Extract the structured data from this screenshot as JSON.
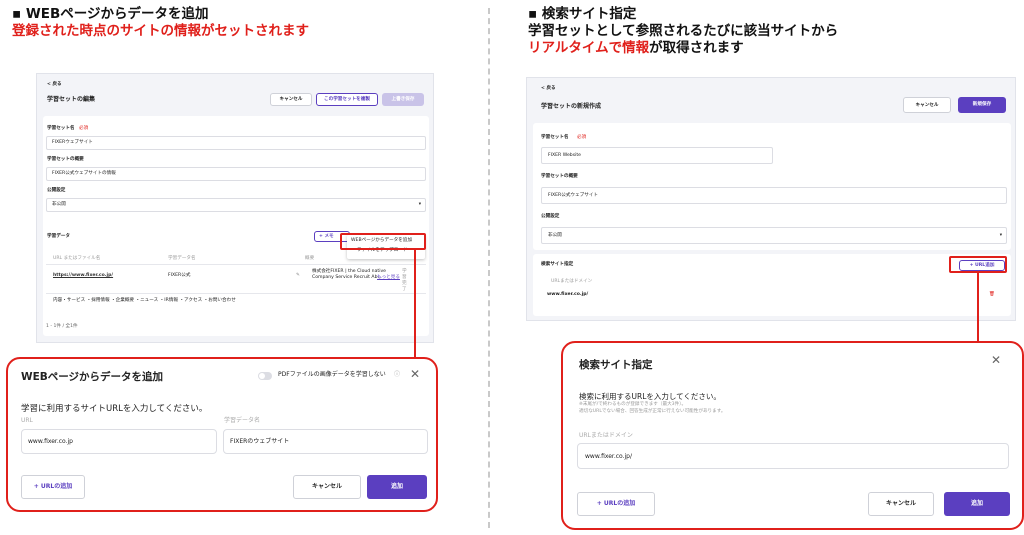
{
  "left": {
    "heading": "▪ WEBページからデータを追加",
    "subheading": "登録された時点のサイトの情報がセットされます",
    "screen": {
      "back": "< 戻る",
      "title": "学習セットの編集",
      "cancel": "キャンセル",
      "copy_button": "この学習セットを複製",
      "save_button": "上書き保存",
      "name_label": "学習セット名",
      "required": "必須",
      "name_value": "FIXERウェブサイト",
      "summary_label": "学習セットの概要",
      "summary_value": "FIXER公式ウェブサイトの情報",
      "public_label": "公開設定",
      "public_value": "非公開",
      "data_label": "学習データ",
      "add_memo": "+ メモ",
      "menu_web": "WEBページからデータを追加",
      "menu_file": "ファイルをアップロード",
      "col_url": "URL またはファイル名",
      "col_name": "学習データ名",
      "col_summary": "概要",
      "row_url": "https://www.fixer.co.jp/",
      "row_name": "FIXER公式",
      "row_summary_1": "株式会社FIXER | the Cloud native",
      "row_summary_2": "Company Service Recruit Ab...",
      "row_more": "もっと見る",
      "row_status": "学習完了",
      "row_tags": "内容・サービス ・採用情報 ・企業概要 ・ニュース ・IR情報 ・アクセス ・お問い合わせ",
      "pagination": "1 - 1件 / 全1件"
    },
    "modal": {
      "title": "WEBページからデータを追加",
      "toggle_label": "PDFファイルの画像データを学習しない",
      "info_icon": "ⓘ",
      "close_icon": "✕",
      "instruction": "学習に利用するサイトURLを入力してください。",
      "url_label": "URL",
      "url_value": "www.fixer.co.jp",
      "name_label": "学習データ名",
      "name_value": "FIXERのウェブサイト",
      "add_url": "+ URLの追加",
      "cancel": "キャンセル",
      "submit": "追加"
    }
  },
  "right": {
    "heading": "▪ 検索サイト指定",
    "subheading_1": "学習セットとして参照されるたびに該当サイトから",
    "subheading_2_red": "リアルタイムで情報",
    "subheading_2_rest": "が取得されます",
    "screen": {
      "back": "< 戻る",
      "title": "学習セットの新規作成",
      "cancel": "キャンセル",
      "save_button": "新規保存",
      "name_label": "学習セット名",
      "required": "必須",
      "name_value": "FIXER Website",
      "summary_label": "学習セットの概要",
      "summary_value": "FIXER公式ウェブサイト",
      "public_label": "公開設定",
      "public_value": "非公開",
      "search_label": "検索サイト指定",
      "url_add": "+ URL追加",
      "url_col": "URLまたはドメイン",
      "url_value": "www.fixer.co.jp/"
    },
    "modal": {
      "title": "検索サイト指定",
      "close_icon": "✕",
      "instruction": "検索に利用するURLを入力してください。",
      "note_1": "※末尾が/で終わるものが登録できます（最大3件）。",
      "note_2": "適切なURLでない場合、回答生成が正常に行えない可能性があります。",
      "url_label": "URLまたはドメイン",
      "url_value": "www.fixer.co.jp/",
      "add_url": "+ URLの追加",
      "cancel": "キャンセル",
      "submit": "追加"
    }
  },
  "colors": {
    "accent": "#5b3fc0",
    "highlight": "#e0201b"
  }
}
